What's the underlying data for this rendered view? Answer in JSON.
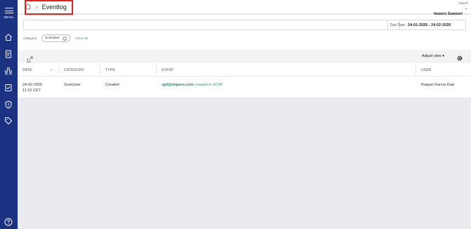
{
  "sidebar": {
    "menu_label": "MENU",
    "items": [
      {
        "icon": "home-icon"
      },
      {
        "icon": "document-icon"
      },
      {
        "icon": "people-icon"
      },
      {
        "icon": "checklist-icon"
      },
      {
        "icon": "alert-shield-icon"
      },
      {
        "icon": "tag-icon"
      }
    ],
    "help_icon": "help-icon"
  },
  "header": {
    "breadcrumb_separator": ">",
    "title": "Eventlog",
    "user_name": "raquel",
    "organization": "Impero Support"
  },
  "filters": {
    "search_placeholder": "",
    "date_label": "Due Date",
    "date_range": "24-01-2026 - 24-02-2026",
    "category_label": "Category",
    "category_chip": "ScimUser",
    "clear_all": "Clear all"
  },
  "toolbar": {
    "adjust_view": "Adjust view"
  },
  "table": {
    "columns": [
      "DATE",
      "CATEGORY",
      "TYPE",
      "EVENT",
      "USER"
    ],
    "rows": [
      {
        "date": "24-02-2026",
        "time": "11:10 CET",
        "category": "ScimUser",
        "type": "Created",
        "event_email": "rgd@impero.com",
        "event_text": "created in SCIM",
        "user": "Raquel Garcia Diaz"
      }
    ]
  },
  "colors": {
    "sidebar": "#1b3283",
    "accent_green": "#2ba673",
    "highlight_red": "#e0241b"
  }
}
